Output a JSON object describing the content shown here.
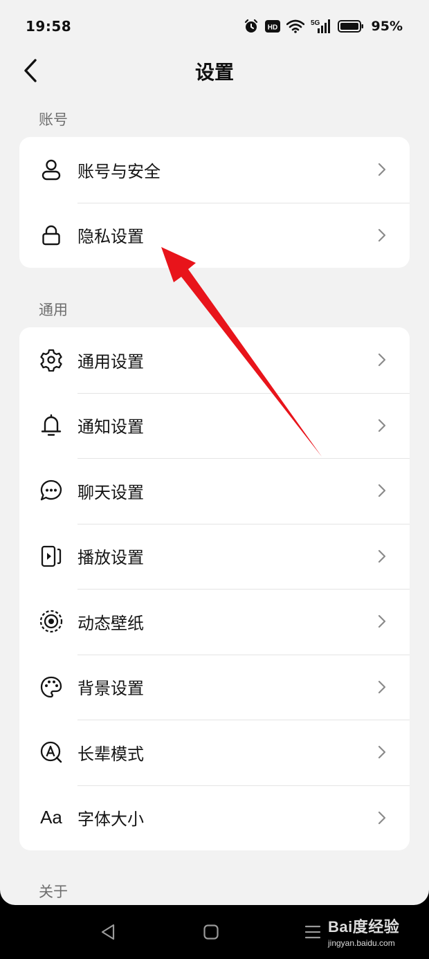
{
  "status_bar": {
    "time": "19:58",
    "network": "5G",
    "hd_badge": "HD",
    "battery": "95%",
    "icons": [
      "alarm-icon",
      "hd-icon",
      "wifi-icon",
      "signal-5g-icon",
      "battery-icon"
    ]
  },
  "header": {
    "title": "设置",
    "back_icon": "back-chevron-icon"
  },
  "sections": [
    {
      "title": "账号",
      "items": [
        {
          "label": "账号与安全",
          "icon": "user-icon"
        },
        {
          "label": "隐私设置",
          "icon": "lock-icon"
        }
      ]
    },
    {
      "title": "通用",
      "items": [
        {
          "label": "通用设置",
          "icon": "gear-icon"
        },
        {
          "label": "通知设置",
          "icon": "bell-icon"
        },
        {
          "label": "聊天设置",
          "icon": "chat-bubble-icon"
        },
        {
          "label": "播放设置",
          "icon": "play-icon"
        },
        {
          "label": "动态壁纸",
          "icon": "live-wallpaper-icon"
        },
        {
          "label": "背景设置",
          "icon": "palette-icon"
        },
        {
          "label": "长辈模式",
          "icon": "elder-mode-icon"
        },
        {
          "label": "字体大小",
          "icon": "font-size-icon",
          "glyph": "Aa"
        }
      ]
    },
    {
      "title": "关于",
      "items": []
    }
  ],
  "annotation": {
    "type": "red-arrow",
    "color": "#e8141b",
    "points_to": "隐私设置"
  },
  "nav_bar": {
    "icons": [
      "nav-back-icon",
      "nav-home-icon",
      "nav-menu-icon"
    ]
  },
  "watermark": {
    "logo": "Bai度经验",
    "url": "jingyan.baidu.com"
  }
}
